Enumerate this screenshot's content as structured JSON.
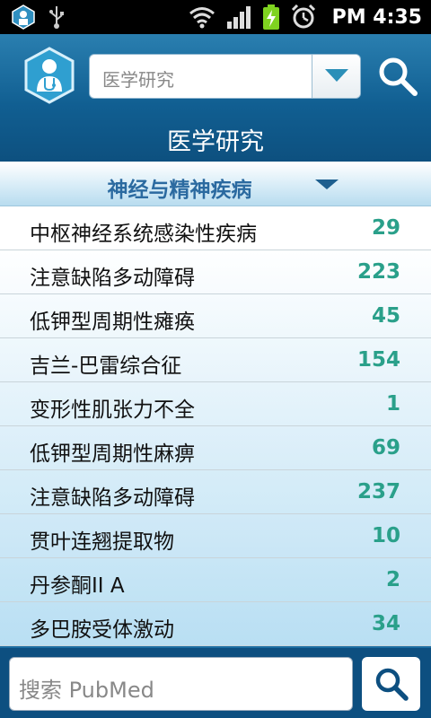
{
  "status_bar": {
    "time": "PM 4:35",
    "icons": [
      "app-notification-icon",
      "usb-icon",
      "wifi-icon",
      "signal-icon",
      "battery-charging-icon",
      "alarm-icon"
    ]
  },
  "header": {
    "search_value": "医学研究",
    "title": "医学研究"
  },
  "category": {
    "label": "神经与精神疾病"
  },
  "list": {
    "items": [
      {
        "name": "中枢神经系统感染性疾病",
        "count": "29"
      },
      {
        "name": "注意缺陷多动障碍",
        "count": "223"
      },
      {
        "name": "低钾型周期性瘫痪",
        "count": "45"
      },
      {
        "name": "吉兰-巴雷综合征",
        "count": "154"
      },
      {
        "name": "变形性肌张力不全",
        "count": "1"
      },
      {
        "name": "低钾型周期性麻痹",
        "count": "69"
      },
      {
        "name": "注意缺陷多动障碍",
        "count": "237"
      },
      {
        "name": "贯叶连翘提取物",
        "count": "10"
      },
      {
        "name": "丹参酮II A",
        "count": "2"
      },
      {
        "name": "多巴胺受体激动",
        "count": "34"
      }
    ]
  },
  "bottom_search": {
    "placeholder": "搜索 PubMed"
  },
  "colors": {
    "header": "#115f92",
    "count": "#2aa08a",
    "category_text": "#2b6aa0"
  }
}
